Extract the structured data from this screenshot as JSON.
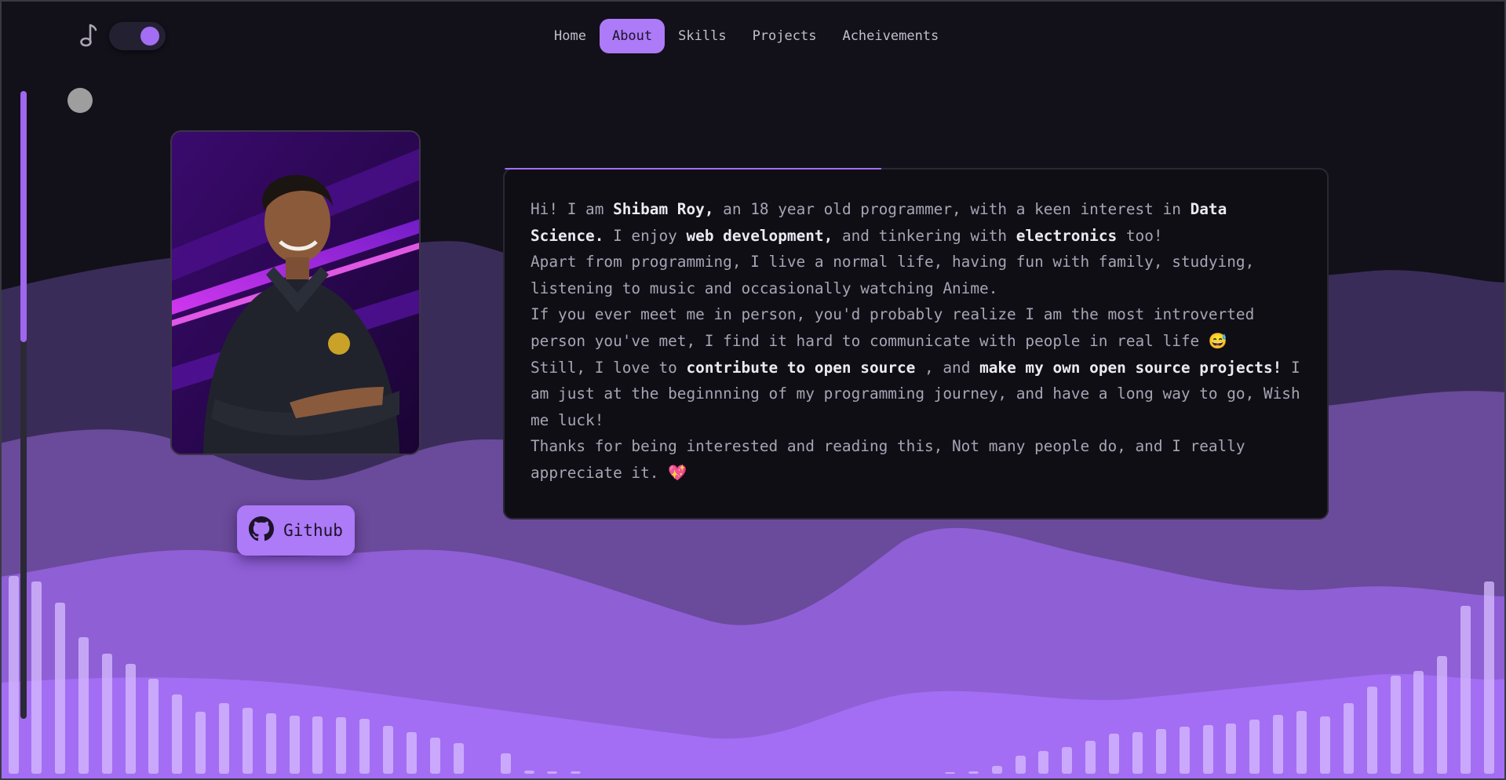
{
  "nav": {
    "items": [
      {
        "label": "Home",
        "active": false
      },
      {
        "label": "About",
        "active": true
      },
      {
        "label": "Skills",
        "active": false
      },
      {
        "label": "Projects",
        "active": false
      },
      {
        "label": "Acheivements",
        "active": false
      }
    ]
  },
  "controls": {
    "music_icon": "music-note-icon",
    "theme_toggle_on": true
  },
  "github": {
    "label": "Github",
    "icon": "github-icon"
  },
  "about": {
    "p1": {
      "a": "Hi! I am ",
      "name": "Shibam Roy,",
      "b": " an 18 year old programmer, with a keen interest in ",
      "interest": "Data Science.",
      "c": " I enjoy ",
      "web": "web development,",
      "d": " and tinkering with ",
      "electronics": "electronics",
      "e": " too!"
    },
    "p2": "Apart from programming, I live a normal life, having fun with family, studying, listening to music and occasionally watching Anime.",
    "p3": "If you ever meet me in person, you'd probably realize I am the most introverted person you've met, I find it hard to communicate with people in real life 😅",
    "p4": {
      "a": "Still, I love to ",
      "oss": "contribute to open source",
      "b": " , and ",
      "own": "make my own open source projects!",
      "c": " I am just at the beginnning of my programming journey, and have a long way to go, Wish me luck!"
    },
    "p5": "Thanks for being interested and reading this, Not many people do, and I really appreciate it. 💖"
  },
  "colors": {
    "accent": "#ad7af8",
    "background": "#121019",
    "card": "#0f0e15"
  }
}
